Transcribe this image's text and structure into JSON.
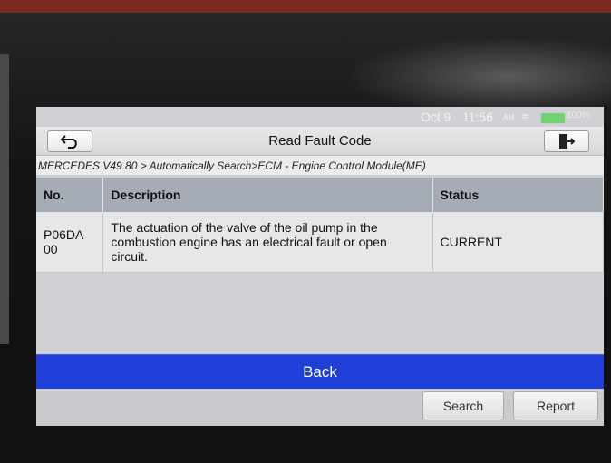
{
  "status_bar": {
    "date": "Oct 9",
    "time": "11:56",
    "ampm": "AM",
    "battery": "100%",
    "wifi_icon": "wifi-icon",
    "battery_icon": "battery-icon"
  },
  "header": {
    "title": "Read Fault Code",
    "back_icon": "return-arrow-icon",
    "exit_icon": "exit-door-icon"
  },
  "breadcrumb": "MERCEDES V49.80 > Automatically Search>ECM - Engine Control Module(ME)",
  "table": {
    "headers": [
      "No.",
      "Description",
      "Status"
    ],
    "rows": [
      {
        "code": "P06DA\n00",
        "description": "The actuation of the valve of the oil pump in the combustion engine has an electrical fault or open circuit.",
        "status": "CURRENT"
      }
    ]
  },
  "buttons": {
    "back": "Back",
    "search": "Search",
    "report": "Report"
  },
  "colors": {
    "accent": "#1f3fd8",
    "header_bg": "#a6acb6"
  }
}
